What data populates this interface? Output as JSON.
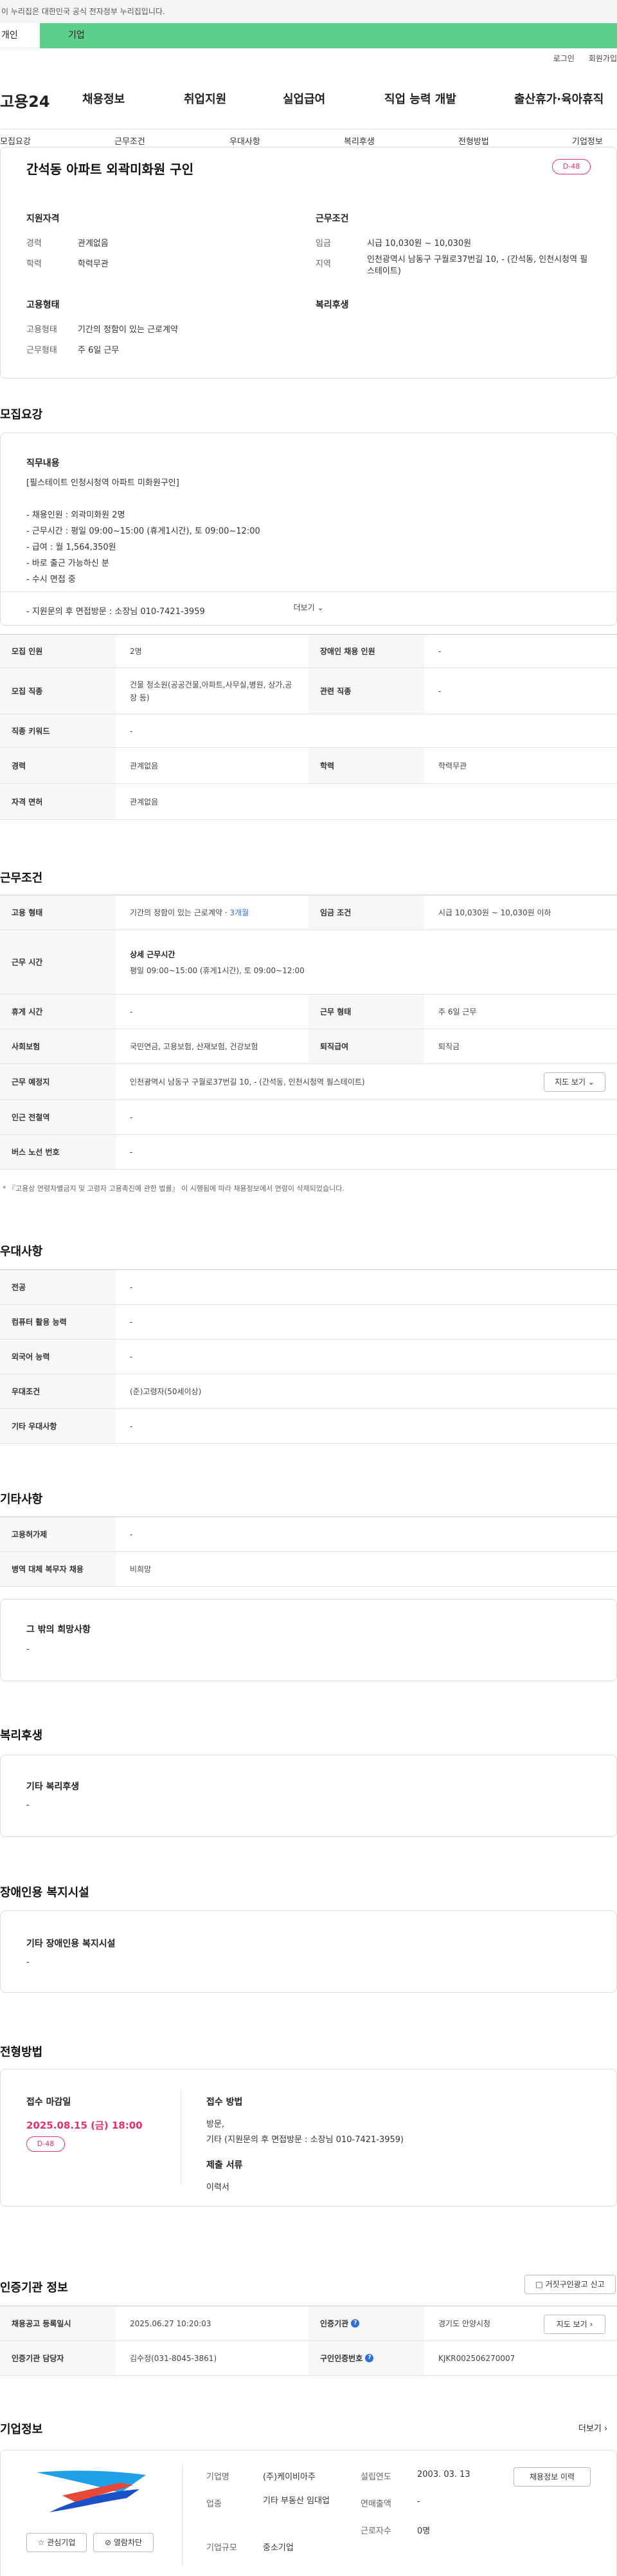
{
  "gov_banner": "이 누리집은 대한민국 공식 전자정부 누리집입니다.",
  "tabs": {
    "individual": "개인",
    "business": "기업"
  },
  "util": {
    "login": "로그인",
    "signup": "회원가입"
  },
  "logo": "고용24",
  "gnb": [
    "채용정보",
    "취업지원",
    "실업급여",
    "직업 능력 개발",
    "출산휴가·육아휴직"
  ],
  "anchors": [
    "모집요강",
    "근무조건",
    "우대사항",
    "복리후생",
    "전형방법",
    "기업정보"
  ],
  "summary": {
    "title": "간석동 아파트 외곽미화원 구인",
    "dday": "D-48",
    "qual_title": "지원자격",
    "career_label": "경력",
    "career": "관계없음",
    "edu_label": "학력",
    "edu": "학력무관",
    "cond_title": "근무조건",
    "wage_label": "임금",
    "wage": "시급 10,030원 ~ 10,030원",
    "loc_label": "지역",
    "loc": "인천광역시 남동구 구월로37번길 10, - (간석동, 인천시청역 필스테이트)",
    "emp_title": "고용형태",
    "emptype_label": "고용형태",
    "emptype": "기간의 정함이 있는 근로계약",
    "worktype_label": "근무형태",
    "worktype": "주 6일 근무",
    "welfare_title": "복리후생"
  },
  "recruit": {
    "title": "모집요강",
    "duty_title": "직무내용",
    "duty_lines": [
      "[필스테이트 인청시청역 아파트 미화원구인]",
      "",
      "- 채용인원 : 외곽미화원 2명",
      "- 근무시간 : 평일 09:00~15:00 (휴게1시간), 토 09:00~12:00",
      "- 급여 : 월 1,564,350원",
      "- 바로 출근 가능하신 분",
      "- 수시 면접 중",
      "",
      "- 지원문의 후 면접방문 : 소장님 010-7421-3959"
    ],
    "more": "더보기",
    "rows": [
      [
        "모집 인원",
        "2명",
        "장애인 채용 인원",
        "-"
      ],
      [
        "모집 직종",
        "건물 청소원(공공건물,아파트,사무실,병원, 상가,공장 등)",
        "관련 직종",
        "-"
      ],
      [
        "직종 키워드",
        "-"
      ],
      [
        "경력",
        "관계없음",
        "학력",
        "학력무관"
      ],
      [
        "자격 면허",
        "관계없음"
      ]
    ]
  },
  "work": {
    "title": "근무조건",
    "emp_label": "고용 형태",
    "emp_value": "기간의 정함이 있는 근로계약",
    "emp_months": "3개월",
    "wage_label": "임금 조건",
    "wage_value": "시급 10,030원 ~ 10,030원 이하",
    "time_label": "근무 시간",
    "time_sub": "상세 근무시간",
    "time_value": "평일 09:00~15:00 (휴게1시간), 토 09:00~12:00",
    "rest_label": "휴게 시간",
    "rest_value": "-",
    "form_label": "근무 형태",
    "form_value": "주 6일 근무",
    "ins_label": "사회보험",
    "ins_value": "국민연금, 고용보험, 산재보험, 건강보험",
    "sev_label": "퇴직급여",
    "sev_value": "퇴직금",
    "place_label": "근무 예정지",
    "place_value": "인천광역시 남동구 구월로37번길 10, - (간석동, 인천시청역 필스테이트)",
    "map_btn": "지도 보기",
    "subway_label": "인근 전철역",
    "subway_value": "-",
    "bus_label": "버스 노선 번호",
    "bus_value": "-",
    "note": "* 『고용상 연령차별금지 및 고령자 고용촉진에 관한 법률』 이 시행됨에 따라 채용정보에서 연령이 삭제되었습니다."
  },
  "pref": {
    "title": "우대사항",
    "rows": [
      [
        "전공",
        "-"
      ],
      [
        "컴퓨터 활용 능력",
        "-"
      ],
      [
        "외국어 능력",
        "-"
      ],
      [
        "우대조건",
        "(준)고령자(50세이상)"
      ],
      [
        "기타 우대사항",
        "-"
      ]
    ]
  },
  "etc": {
    "title": "기타사항",
    "rows": [
      [
        "고용허가제",
        "-"
      ],
      [
        "병역 대체 복무자 채용",
        "비희망"
      ]
    ],
    "other_title": "그 밖의 희망사항",
    "other_value": "-"
  },
  "welfare": {
    "title": "복리후생",
    "box_title": "기타 복리후생",
    "box_value": "-"
  },
  "disab": {
    "title": "장애인용 복지시설",
    "box_title": "기타 장애인용 복지시설",
    "box_value": "-"
  },
  "select": {
    "title": "전형방법",
    "deadline_title": "접수 마감일",
    "deadline": "2025.08.15 (금) 18:00",
    "dday": "D-48",
    "method_title": "접수 방법",
    "method_lines": [
      "방문,",
      "기타 (지원문의 후 면접방문 : 소장님 010-7421-3959)"
    ],
    "docs_title": "제출 서류",
    "docs": "이력서"
  },
  "cert": {
    "title": "인증기관 정보",
    "report_btn": "거짓구인광고 신고",
    "rows": [
      [
        "채용공고 등록일시",
        "2025.06.27 10:20:03",
        "인증기관",
        "경기도 안양시청",
        "지도 보기"
      ],
      [
        "인증기관 담당자",
        "김수정(031-8045-3861)",
        "구인인증번호",
        "KJKR002506270007"
      ]
    ]
  },
  "company": {
    "title": "기업정보",
    "more": "더보기",
    "fav_btn": "관심기업",
    "block_btn": "열람차단",
    "name_label": "기업명",
    "name": "(주)케이비아주",
    "ind_label": "업종",
    "ind": "기타 부동산 임대업",
    "size_label": "기업규모",
    "size": "중소기업",
    "est_label": "설립연도",
    "est": "2003. 03. 13",
    "sales_label": "연매출액",
    "sales": "-",
    "emp_label": "근로자수",
    "emp": "0명",
    "history_btn": "채용정보 이력"
  },
  "colors": {
    "accent": "#5dcf8a",
    "dday": "#e0336a",
    "month": "#2f6fd6"
  }
}
